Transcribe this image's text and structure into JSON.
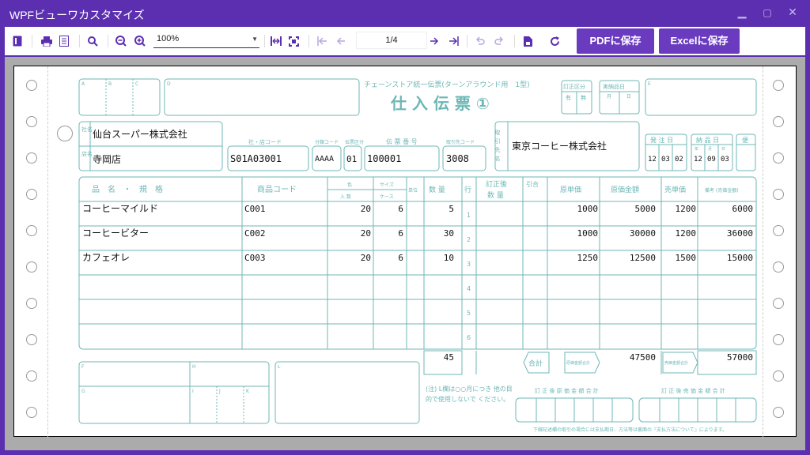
{
  "window": {
    "title": "WPFビューワカスタマイズ"
  },
  "toolbar": {
    "zoom": "100%",
    "page": "1/4",
    "pdf_label": "PDFに保存",
    "excel_label": "Excelに保存"
  },
  "form": {
    "title_small": "チェーンストア統一伝票(ターンアラウンド用　1型)",
    "title_big": "仕 入 伝 票 ①",
    "label_teisei": "訂正区分",
    "label_yes": "有",
    "label_no": "無",
    "label_jisshi": "実納品日",
    "label_month": "月",
    "label_day": "日",
    "corner_A": "A",
    "corner_B": "B",
    "corner_C": "C",
    "corner_D": "D",
    "corner_E": "E",
    "label_shamei": "社名",
    "label_tenmei": "店名",
    "company": "仙台スーパー株式会社",
    "store": "寺岡店",
    "label_shaten_code": "社・店コード",
    "shaten_code": "S01A03001",
    "label_bunrui": "分類コード",
    "bunrui": "AAAA",
    "label_denkubun": "伝票区分",
    "denkubun": "01",
    "label_denban": "伝 票 番 号",
    "denban": "100001",
    "label_torihiki": "取引先コード",
    "torihiki": "3008",
    "label_torihikisaki": "取引先名",
    "supplier": "東京コーヒー株式会社",
    "label_hatchu": "発 注 日",
    "hatchu_m": "12",
    "hatchu_mm": "03",
    "hatchu_d": "02",
    "label_nohin": "納 品 日",
    "nohin_m": "12",
    "nohin_mm": "09",
    "nohin_d": "03",
    "label_bin": "便",
    "label_nen": "年",
    "h_item": "品　名　・　規　格",
    "h_code": "商品コード",
    "h_iro": "色",
    "h_size": "サイズ",
    "h_irisu": "入 数",
    "h_case": "ケース",
    "h_tani": "単位",
    "h_qty": "数 量",
    "h_gyo": "行",
    "h_teisei": "訂正後",
    "h_teisei_qty": "数 量",
    "h_hikiai": "引合",
    "h_genka": "原単価",
    "h_genkakin": "原価金額",
    "h_baika": "売単価",
    "h_biko": "備考 (売価金額)",
    "rows": [
      {
        "name": "コーヒーマイルド",
        "code": "C001",
        "irisu": "20",
        "case": "6",
        "qty": "5",
        "gyo": "1",
        "genka": "1000",
        "genkakin": "5000",
        "baika": "1200",
        "baikakin": "6000"
      },
      {
        "name": "コーヒービター",
        "code": "C002",
        "irisu": "20",
        "case": "6",
        "qty": "30",
        "gyo": "2",
        "genka": "1000",
        "genkakin": "30000",
        "baika": "1200",
        "baikakin": "36000"
      },
      {
        "name": "カフェオレ",
        "code": "C003",
        "irisu": "20",
        "case": "6",
        "qty": "10",
        "gyo": "3",
        "genka": "1250",
        "genkakin": "12500",
        "baika": "1500",
        "baikakin": "15000"
      },
      {
        "name": "",
        "code": "",
        "irisu": "",
        "case": "",
        "qty": "",
        "gyo": "4",
        "genka": "",
        "genkakin": "",
        "baika": "",
        "baikakin": ""
      },
      {
        "name": "",
        "code": "",
        "irisu": "",
        "case": "",
        "qty": "",
        "gyo": "5",
        "genka": "",
        "genkakin": "",
        "baika": "",
        "baikakin": ""
      },
      {
        "name": "",
        "code": "",
        "irisu": "",
        "case": "",
        "qty": "",
        "gyo": "6",
        "genka": "",
        "genkakin": "",
        "baika": "",
        "baikakin": ""
      }
    ],
    "total_qty": "45",
    "label_gokei": "合計",
    "label_genka_gokei": "原価金額合計",
    "total_genka": "47500",
    "label_baika_gokei": "売価金額合計",
    "total_baika": "57000",
    "corner_F": "F",
    "corner_G": "G",
    "corner_H": "H",
    "corner_I": "I",
    "corner_J": "J",
    "corner_K": "K",
    "corner_L": "L",
    "note": "(注) L欄は○○月につき 他の目的で使用しないで ください。",
    "label_teisei_genka": "訂 正 後 原 価 金 額 合 計",
    "label_teisei_baika": "訂 正 後 売 価 金 額 合 計",
    "footer": "下線記述欄の取引の場合には支払期日、方法等は裏面の『支払方法について』によります。"
  }
}
